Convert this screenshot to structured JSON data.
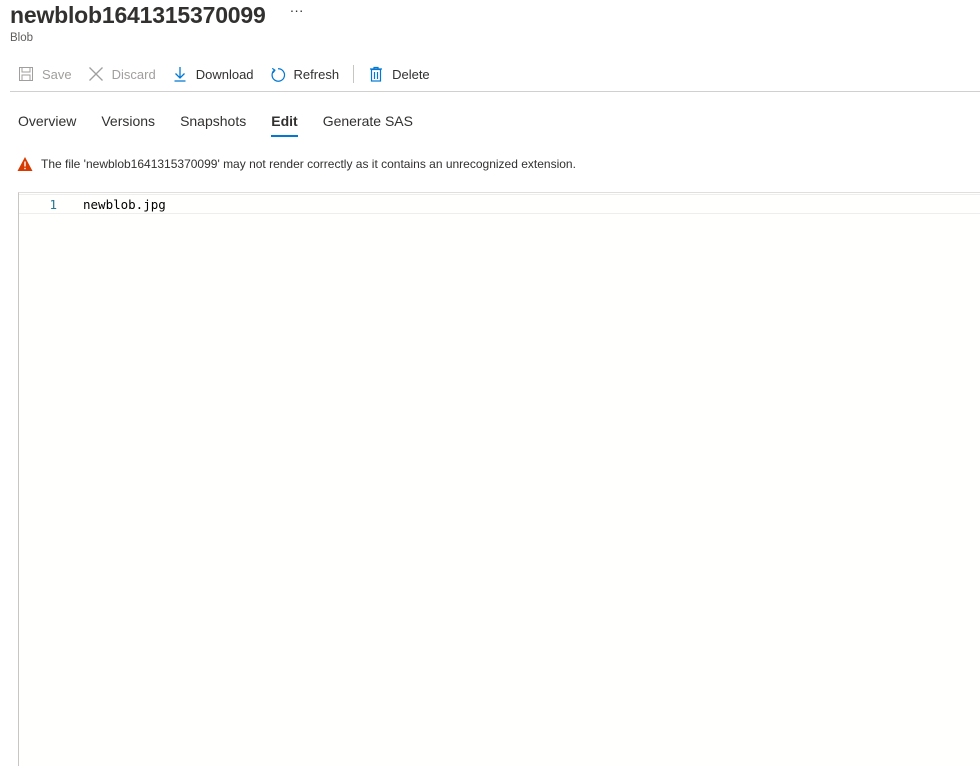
{
  "header": {
    "title": "newblob1641315370099",
    "more": "···",
    "subtitle": "Blob"
  },
  "toolbar": {
    "save_label": "Save",
    "discard_label": "Discard",
    "download_label": "Download",
    "refresh_label": "Refresh",
    "delete_label": "Delete"
  },
  "tabs": [
    {
      "label": "Overview"
    },
    {
      "label": "Versions"
    },
    {
      "label": "Snapshots"
    },
    {
      "label": "Edit",
      "active": true
    },
    {
      "label": "Generate SAS"
    }
  ],
  "warning": {
    "text": "The file 'newblob1641315370099' may not render correctly as it contains an unrecognized extension."
  },
  "editor": {
    "lines": [
      {
        "number": "1",
        "text": "newblob.jpg"
      }
    ]
  },
  "colors": {
    "accent": "#0078d4",
    "warning": "#d83b01",
    "line_number": "#237893"
  }
}
